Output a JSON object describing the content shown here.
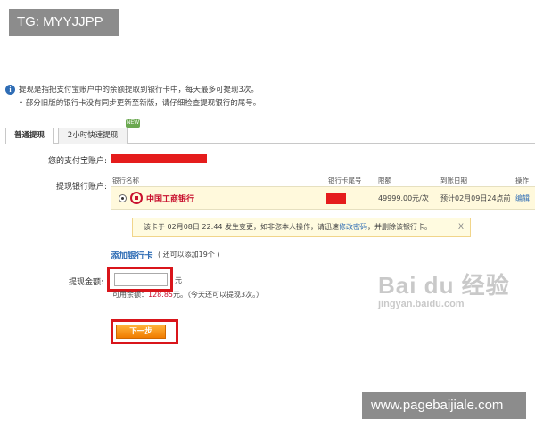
{
  "overlay": {
    "tg_badge": "TG: MYYJJPP",
    "site_badge": "www.pagebaijiale.com",
    "watermark_brand": "Bai du 经验",
    "watermark_url": "jingyan.baidu.com"
  },
  "notice": {
    "icon": "info-icon",
    "line1": "提现是指把支付宝账户中的余额提取到银行卡中，每天最多可提现3次。",
    "line2": "• 部分旧版的银行卡没有同步更新至新版，请仔细检查提现银行的尾号。"
  },
  "tabs": [
    {
      "label": "普通提现",
      "active": true
    },
    {
      "label": "2小时快速提现",
      "active": false
    }
  ],
  "new_badge": "NEW",
  "form": {
    "alipay_account_label": "您的支付宝账户:",
    "bank_account_label": "提现银行账户:",
    "amount_label": "提现金额:",
    "amount_value": "",
    "amount_unit": "元"
  },
  "account_table": {
    "headers": {
      "bank_name": "银行名称",
      "card_tail": "银行卡尾号",
      "limit": "限额",
      "arrival": "到账日期",
      "action": "操作"
    },
    "row": {
      "bank_name": "中国工商银行",
      "limit": "49999.00元/次",
      "arrival": "预计02月09日24点前",
      "action": "编辑"
    }
  },
  "warning": {
    "text_before": "该卡于 02月08日 22:44 发生变更，如非您本人操作，请迅速",
    "link": "修改密码",
    "text_after": "，并删除该银行卡。",
    "close": "X"
  },
  "add_card": {
    "label": "添加银行卡",
    "note": "( 还可以添加19个 )"
  },
  "balance": {
    "prefix": "可用余额：",
    "amount": "128.85",
    "suffix": "元。（今天还可以提现3次。）"
  },
  "next_button": "下一步",
  "colors": {
    "accent_red": "#d9151b",
    "link_blue": "#2f6db5",
    "button_orange": "#f07c00"
  }
}
